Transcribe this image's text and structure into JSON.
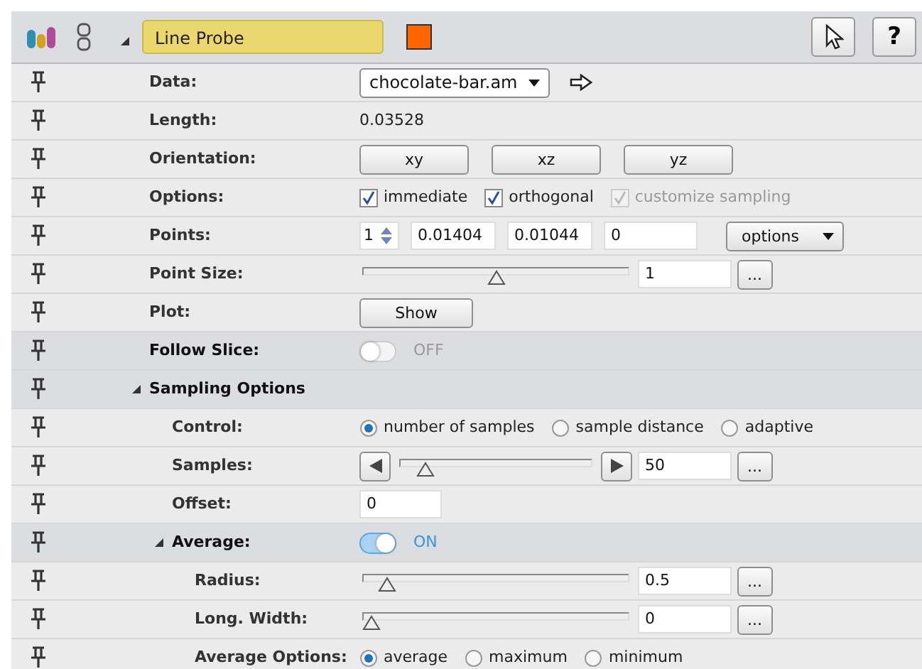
{
  "header": {
    "title": "Line Probe",
    "color": "#ff6600",
    "expanded": true,
    "help": "?"
  },
  "rows": [
    {
      "kind": "dropdown",
      "label": "Data:",
      "value": "chocolate-bar.am"
    },
    {
      "kind": "text",
      "label": "Length:",
      "value": "0.03528"
    },
    {
      "kind": "buttons",
      "label": "Orientation:",
      "buttons": [
        "xy",
        "xz",
        "yz"
      ]
    },
    {
      "kind": "checkboxes",
      "label": "Options:",
      "options": [
        {
          "label": "immediate",
          "checked": true,
          "disabled": false
        },
        {
          "label": "orthogonal",
          "checked": true,
          "disabled": false
        },
        {
          "label": "customize sampling",
          "checked": true,
          "disabled": true
        }
      ]
    },
    {
      "kind": "points",
      "label": "Points:",
      "count": "1",
      "values": [
        "0.01404",
        "0.01044",
        "0"
      ],
      "menu": "options"
    },
    {
      "kind": "slider",
      "label": "Point Size:",
      "level": 0.5,
      "value": "1",
      "more": "..."
    },
    {
      "kind": "button",
      "label": "Plot:",
      "button": "Show"
    },
    {
      "kind": "toggle",
      "label": "Follow Slice:",
      "on": false,
      "state": "OFF"
    },
    {
      "kind": "section",
      "label": "Sampling Options",
      "expanded": true,
      "children": [
        {
          "kind": "radios",
          "label": "Control:",
          "options": [
            {
              "label": "number of samples",
              "selected": true
            },
            {
              "label": "sample distance",
              "selected": false
            },
            {
              "label": "adaptive",
              "selected": false
            }
          ]
        },
        {
          "kind": "stepper",
          "label": "Samples:",
          "level": 0.1,
          "value": "50",
          "more": "..."
        },
        {
          "kind": "field",
          "label": "Offset:",
          "value": "0"
        },
        {
          "kind": "toggle",
          "label": "Average:",
          "on": true,
          "state": "ON",
          "expanded": true,
          "children": [
            {
              "kind": "slider",
              "label": "Radius:",
              "level": 0.06,
              "value": "0.5",
              "more": "..."
            },
            {
              "kind": "slider",
              "label": "Long. Width:",
              "level": 0,
              "value": "0",
              "more": "..."
            },
            {
              "kind": "radios",
              "label": "Average Options:",
              "options": [
                {
                  "label": "average",
                  "selected": true
                },
                {
                  "label": "maximum",
                  "selected": false
                },
                {
                  "label": "minimum",
                  "selected": false
                }
              ]
            }
          ]
        }
      ]
    }
  ]
}
